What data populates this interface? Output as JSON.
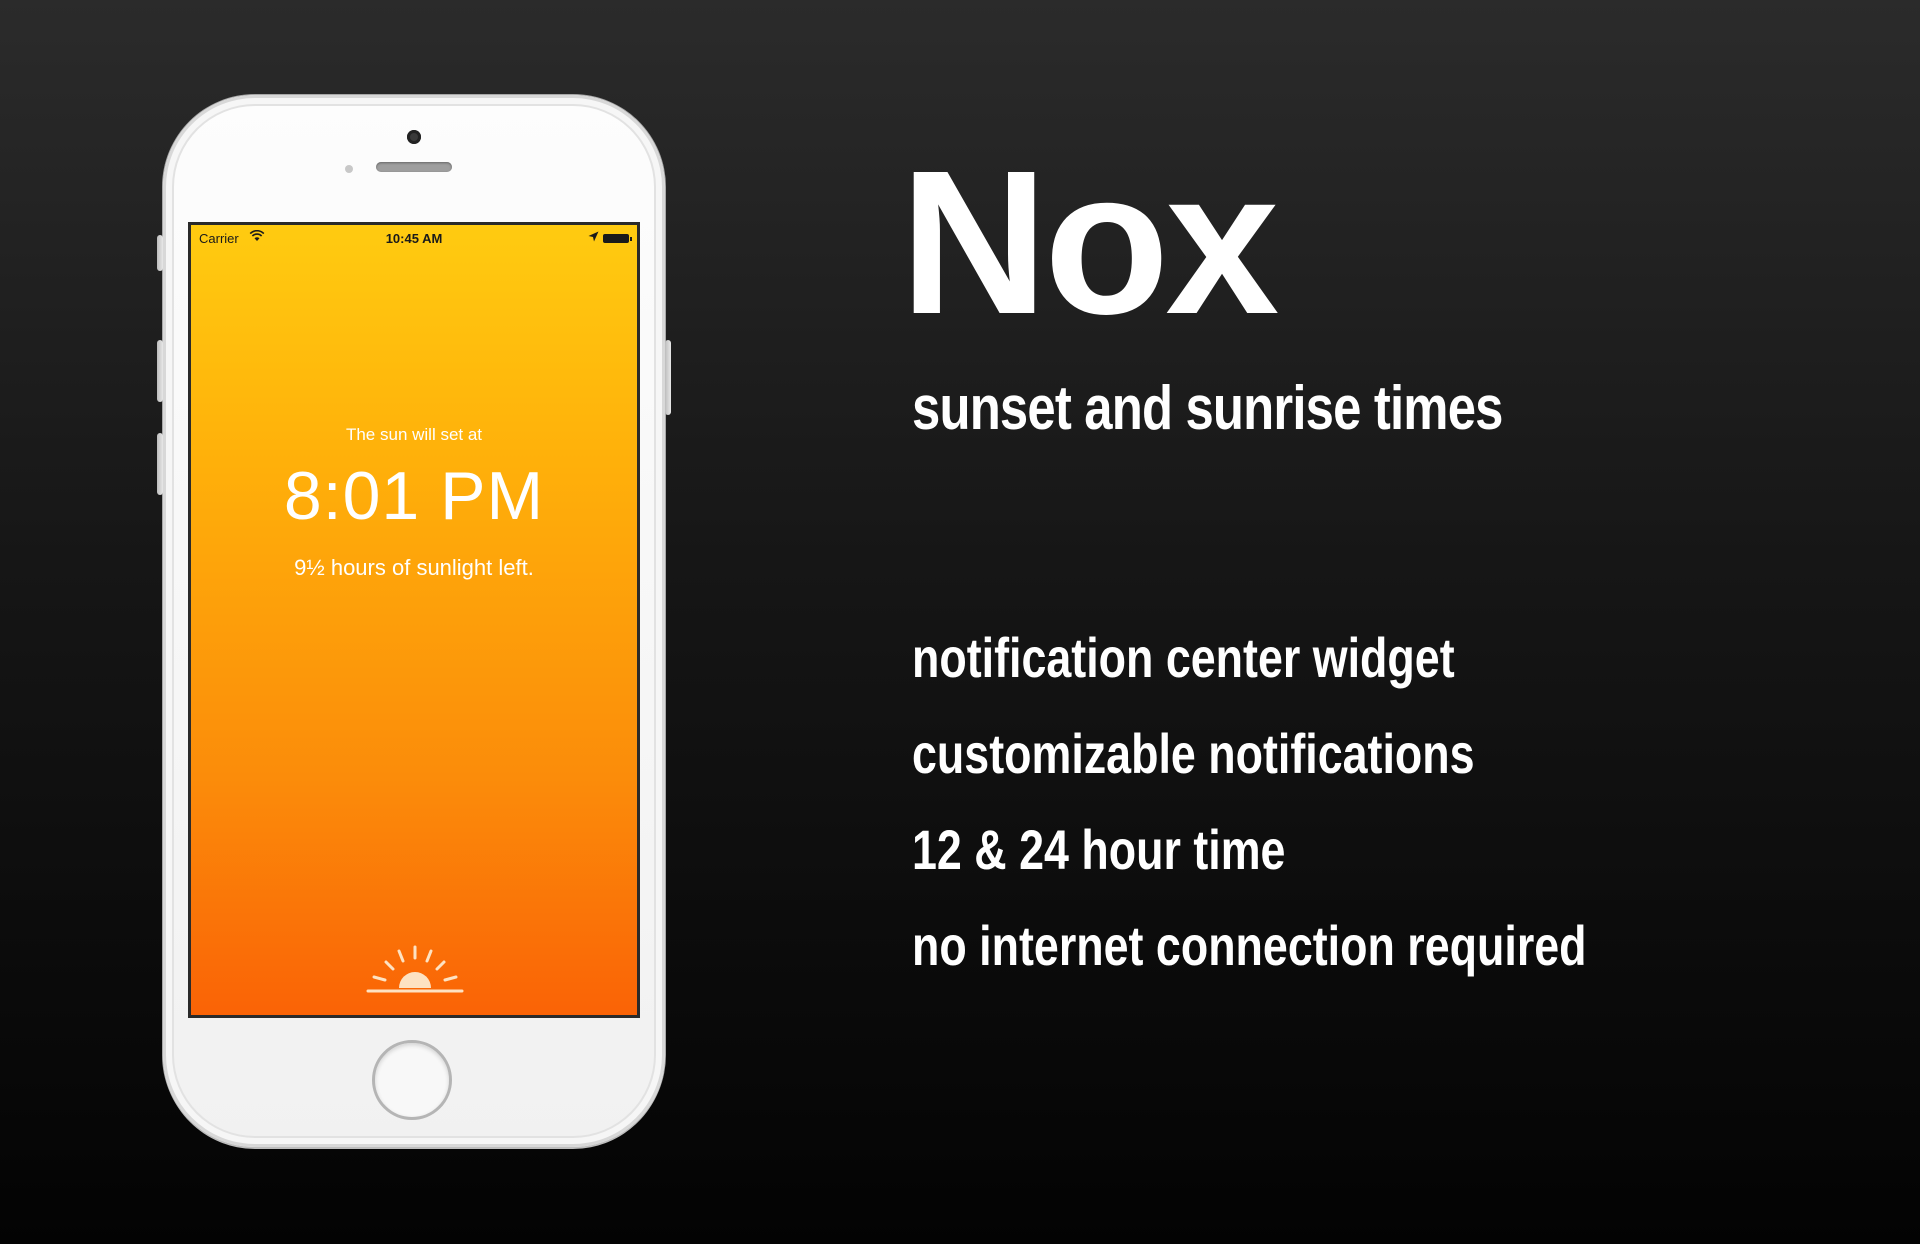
{
  "phone": {
    "status_bar": {
      "carrier": "Carrier",
      "time": "10:45 AM",
      "icons": [
        "wifi-icon",
        "location-icon",
        "battery-icon"
      ]
    },
    "app": {
      "caption": "The sun will set at",
      "time": "8:01 PM",
      "sunlight_left": "9½ hours of sunlight left.",
      "logo_icon": "sun-rays-icon"
    }
  },
  "promo": {
    "title": "Nox",
    "subtitle": "sunset and sunrise times",
    "features": [
      "notification center widget",
      "customizable notifications",
      "12 & 24 hour time",
      "no internet connection required"
    ]
  },
  "colors": {
    "background_top": "#2b2b2b",
    "background_bottom": "#030303",
    "screen_gradient_top": "#ffcb10",
    "screen_gradient_bottom": "#fa6306",
    "text": "#ffffff"
  }
}
